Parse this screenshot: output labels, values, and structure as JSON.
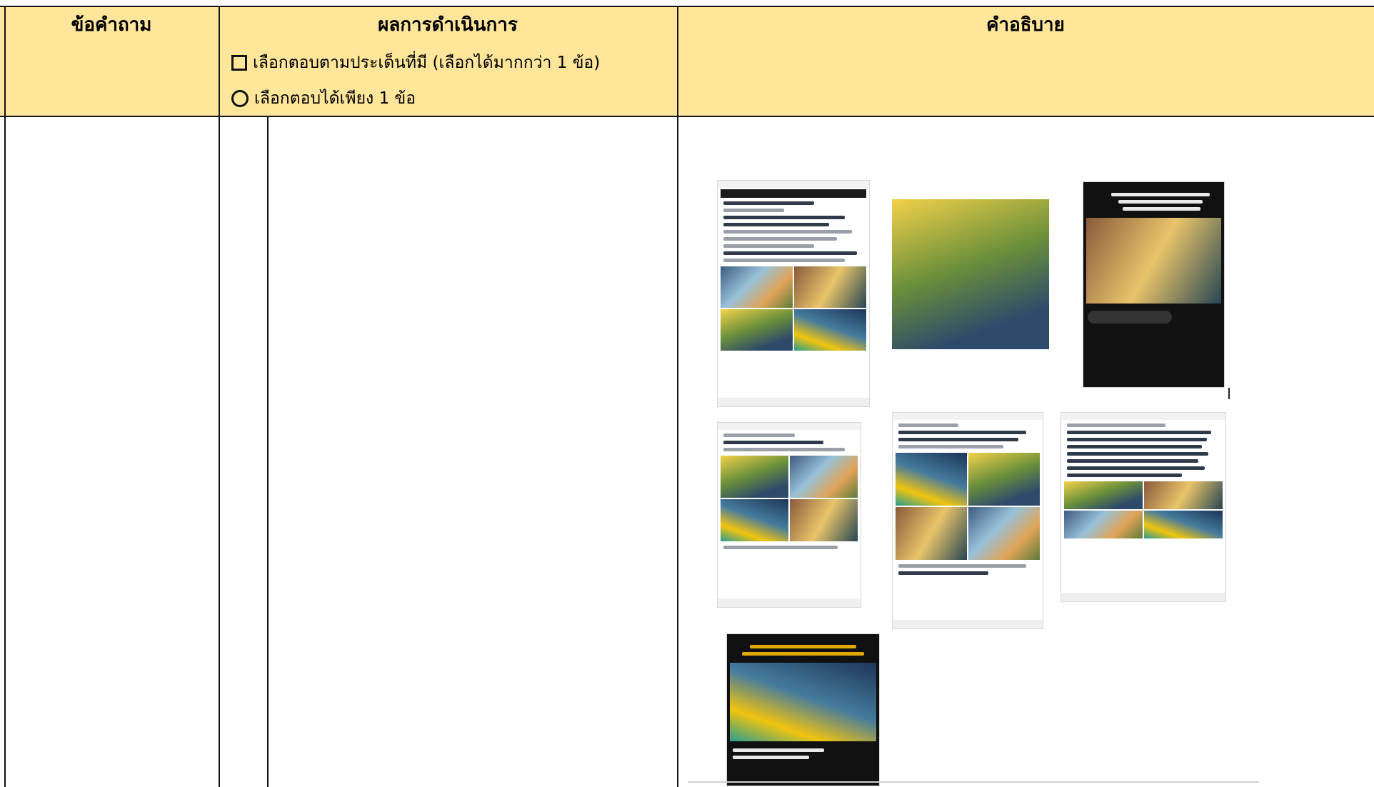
{
  "table": {
    "headers": {
      "question": "ข้อคำถาม",
      "result": "ผลการดำเนินการ",
      "explanation": "คำอธิบาย"
    },
    "options": {
      "multi": "เลือกตอบตามประเด็นที่มี (เลือกได้มากกว่า 1 ข้อ)",
      "single": "เลือกตอบได้เพียง 1 ข้อ"
    }
  },
  "colors": {
    "header_bg": "#ffe69b",
    "border": "#111111"
  },
  "evidence": {
    "items": [
      {
        "name": "facebook-post-screenshot",
        "icon": "phone-screenshot-icon"
      },
      {
        "name": "group-photo",
        "icon": "photo-icon"
      },
      {
        "name": "tiktok-video-screenshot",
        "icon": "phone-screenshot-icon"
      },
      {
        "name": "facebook-post-screenshot-2",
        "icon": "phone-screenshot-icon"
      },
      {
        "name": "facebook-post-screenshot-3",
        "icon": "phone-screenshot-icon"
      },
      {
        "name": "facebook-post-screenshot-4",
        "icon": "phone-screenshot-icon"
      },
      {
        "name": "video-screenshot",
        "icon": "phone-screenshot-icon"
      }
    ]
  }
}
